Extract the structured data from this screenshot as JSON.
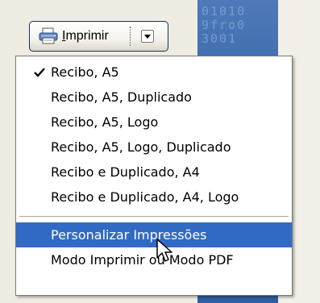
{
  "background": {
    "panel_text": "01010\n9fro0\n3001"
  },
  "toolbar": {
    "print_button": {
      "label_mnemonic": "I",
      "label_rest": "mprimir",
      "icon": "printer-icon",
      "dropdown_icon": "chevron-down-icon"
    }
  },
  "menu": {
    "items_top": [
      {
        "label": "Recibo, A5",
        "checked": true
      },
      {
        "label": "Recibo, A5, Duplicado",
        "checked": false
      },
      {
        "label": "Recibo, A5, Logo",
        "checked": false
      },
      {
        "label": "Recibo, A5, Logo, Duplicado",
        "checked": false
      },
      {
        "label": "Recibo e Duplicado, A4",
        "checked": false
      },
      {
        "label": "Recibo e Duplicado, A4, Logo",
        "checked": false
      }
    ],
    "items_bottom": [
      {
        "label": "Personalizar Impressões",
        "highlighted": true
      },
      {
        "label": "Modo Imprimir ou Modo PDF",
        "highlighted": false
      }
    ],
    "check_icon": "checkmark-icon"
  },
  "colors": {
    "highlight": "#316ac5",
    "button_border": "#1c2f59",
    "background_panel": "#3566a8"
  }
}
